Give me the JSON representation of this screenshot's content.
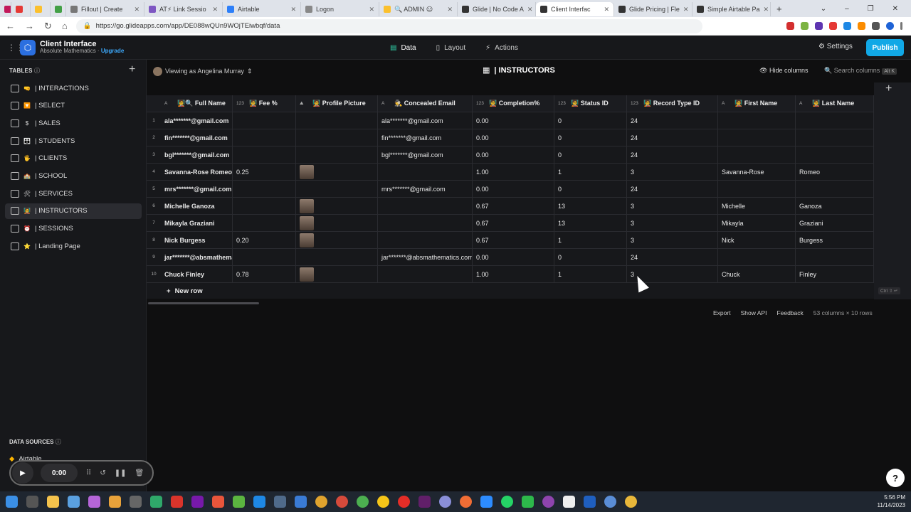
{
  "browser": {
    "tabs": [
      {
        "label": "",
        "color": "#c2185b"
      },
      {
        "label": "",
        "color": "#e53935"
      },
      {
        "label": "",
        "color": "#fbc02d"
      },
      {
        "label": "",
        "color": "#43a047"
      },
      {
        "label": "Fillout | Create",
        "color": "#777777"
      },
      {
        "label": "AT⚡ Link Sessio",
        "color": "#7e57c2"
      },
      {
        "label": "Airtable",
        "color": "#2d7ff9"
      },
      {
        "label": "Logon",
        "color": "#888888"
      },
      {
        "label": "🔍 ADMIN 😐",
        "color": "#fbc02d"
      },
      {
        "label": "Glide | No Code A",
        "color": "#333333"
      },
      {
        "label": "Client Interfac",
        "color": "#333333"
      },
      {
        "label": "Glide Pricing | Fle",
        "color": "#333333"
      },
      {
        "label": "Simple Airtable Pa",
        "color": "#333333"
      }
    ],
    "url": "https://go.glideapps.com/app/DE088wQUn9WOjTEiwbqf/data",
    "window_controls": [
      "⌄",
      "–",
      "❐",
      "✕"
    ]
  },
  "app": {
    "title": "Client Interface",
    "subtitle": "Absolute Mathematics · ",
    "upgrade": "Upgrade",
    "modes": [
      {
        "label": "Data",
        "icon": "▤",
        "active": true
      },
      {
        "label": "Layout",
        "icon": "▯",
        "active": false
      },
      {
        "label": "Actions",
        "icon": "⚡",
        "active": false
      }
    ],
    "settings": "Settings",
    "publish": "Publish"
  },
  "sidebar": {
    "tables_header": "TABLES",
    "items": [
      {
        "emoji": "🤜",
        "label": "| INTERACTIONS"
      },
      {
        "emoji": "🔽",
        "label": "| SELECT"
      },
      {
        "emoji": "$",
        "label": "| SALES"
      },
      {
        "emoji": "👪",
        "label": "| STUDENTS"
      },
      {
        "emoji": "🖐",
        "label": "| CLIENTS"
      },
      {
        "emoji": "🏫",
        "label": "| SCHOOL"
      },
      {
        "emoji": "🛠",
        "label": "| SERVICES"
      },
      {
        "emoji": "🧑‍🏫",
        "label": "| INSTRUCTORS"
      },
      {
        "emoji": "⏰",
        "label": "| SESSIONS"
      },
      {
        "emoji": "⭐",
        "label": "| Landing Page"
      }
    ],
    "selected_index": 7,
    "data_sources_header": "DATA SOURCES",
    "data_source": "Airtable",
    "recorder_time": "0:00"
  },
  "viewbar": {
    "viewing_as": "Viewing as Angelina Murray",
    "table_title": "| INSTRUCTORS",
    "hide_columns": "Hide columns",
    "search_columns": "Search columns",
    "search_shortcut": "Alt K"
  },
  "table": {
    "columns": [
      {
        "type": "A",
        "label": "🧑‍🏫🔍 Full Name"
      },
      {
        "type": "123",
        "label": "🧑‍🏫 Fee %"
      },
      {
        "type": "⛰",
        "label": "🧑‍🏫 Profile Picture"
      },
      {
        "type": "A",
        "label": "🕵 Concealed Email"
      },
      {
        "type": "123",
        "label": "🧑‍🏫 Completion%"
      },
      {
        "type": "123",
        "label": "🧑‍🏫 Status ID"
      },
      {
        "type": "123",
        "label": "🧑‍🏫 Record Type ID"
      },
      {
        "type": "A",
        "label": "🧑‍🏫 First Name"
      },
      {
        "type": "A",
        "label": "🧑‍🏫 Last Name"
      }
    ],
    "rows": [
      {
        "n": "1",
        "name": "ala*******@gmail.com",
        "fee": "",
        "pic": false,
        "email": "ala*******@gmail.com",
        "comp": "0.00",
        "status": "0",
        "rtype": "24",
        "first": "",
        "last": ""
      },
      {
        "n": "2",
        "name": "fin*******@gmail.com",
        "fee": "",
        "pic": false,
        "email": "fin*******@gmail.com",
        "comp": "0.00",
        "status": "0",
        "rtype": "24",
        "first": "",
        "last": ""
      },
      {
        "n": "3",
        "name": "bgl*******@gmail.com",
        "fee": "",
        "pic": false,
        "email": "bgl*******@gmail.com",
        "comp": "0.00",
        "status": "0",
        "rtype": "24",
        "first": "",
        "last": ""
      },
      {
        "n": "4",
        "name": "Savanna-Rose Romeo",
        "fee": "0.25",
        "pic": true,
        "email": "",
        "comp": "1.00",
        "status": "1",
        "rtype": "3",
        "first": "Savanna-Rose",
        "last": "Romeo"
      },
      {
        "n": "5",
        "name": "mrs*******@gmail.com",
        "fee": "",
        "pic": false,
        "email": "mrs*******@gmail.com",
        "comp": "0.00",
        "status": "0",
        "rtype": "24",
        "first": "",
        "last": ""
      },
      {
        "n": "6",
        "name": "Michelle Ganoza",
        "fee": "",
        "pic": true,
        "email": "",
        "comp": "0.67",
        "status": "13",
        "rtype": "3",
        "first": "Michelle",
        "last": "Ganoza"
      },
      {
        "n": "7",
        "name": "Mikayla Graziani",
        "fee": "",
        "pic": true,
        "email": "",
        "comp": "0.67",
        "status": "13",
        "rtype": "3",
        "first": "Mikayla",
        "last": "Graziani"
      },
      {
        "n": "8",
        "name": "Nick Burgess",
        "fee": "0.20",
        "pic": true,
        "email": "",
        "comp": "0.67",
        "status": "1",
        "rtype": "3",
        "first": "Nick",
        "last": "Burgess"
      },
      {
        "n": "9",
        "name": "jar*******@absmathematics.com",
        "fee": "",
        "pic": false,
        "email": "jar*******@absmathematics.com",
        "comp": "0.00",
        "status": "0",
        "rtype": "24",
        "first": "",
        "last": ""
      },
      {
        "n": "10",
        "name": "Chuck Finley",
        "fee": "0.78",
        "pic": true,
        "email": "",
        "comp": "1.00",
        "status": "1",
        "rtype": "3",
        "first": "Chuck",
        "last": "Finley"
      }
    ],
    "new_row": "New row",
    "shortcut_hint": "Ctrl ⇧ ↵"
  },
  "footer": {
    "export": "Export",
    "show_api": "Show API",
    "feedback": "Feedback",
    "dims": "53 columns × 10 rows"
  },
  "taskbar": {
    "time": "5:56 PM",
    "date": "11/14/2023"
  }
}
